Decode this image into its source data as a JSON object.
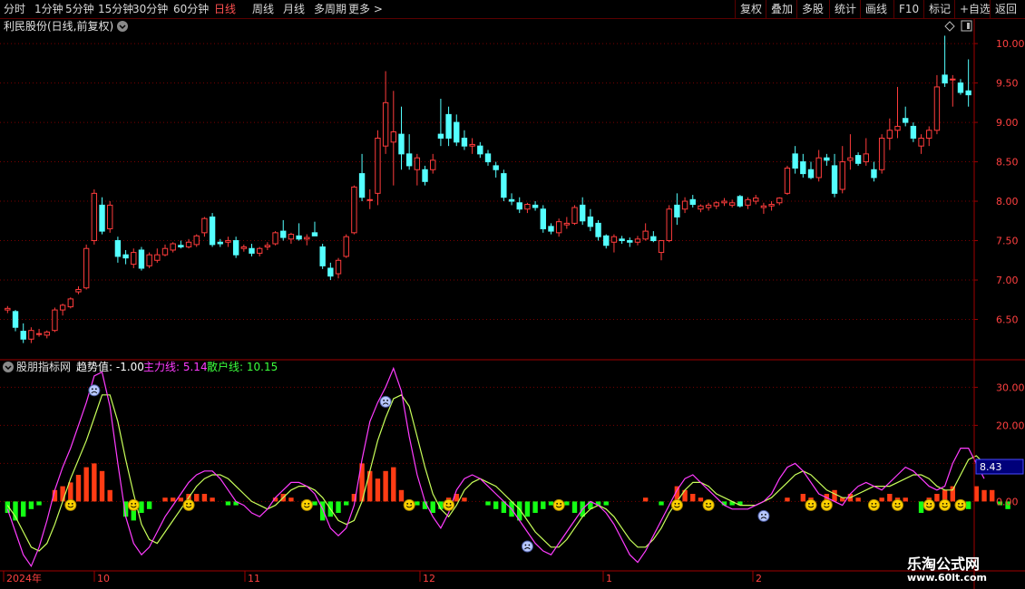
{
  "toolbar": {
    "left": [
      "分时",
      "1分钟",
      "5分钟",
      "15分钟",
      "30分钟",
      "60分钟",
      "日线",
      "周线",
      "月线",
      "多周期",
      "更多 >"
    ],
    "active": "日线",
    "right": [
      "复权",
      "叠加",
      "多股",
      "统计",
      "画线",
      "F10",
      "标记",
      "+自选",
      "返回"
    ]
  },
  "price_panel": {
    "title": "利民股份(日线,前复权)",
    "yticks": [
      "10.00",
      "9.50",
      "9.00",
      "8.50",
      "8.00",
      "7.50",
      "7.00",
      "6.50"
    ]
  },
  "indicator_panel": {
    "name": "股朋指标网",
    "trend_label": "趋势值: -1.00",
    "main_label": "主力线: 5.14",
    "retail_label": "散户线: 10.15",
    "yticks": [
      "30.00",
      "20.00",
      "10.00",
      "0.00"
    ],
    "current_tag": "8.43"
  },
  "xaxis": {
    "labels": [
      "2024年",
      "10",
      "11",
      "12",
      "1",
      "2"
    ]
  },
  "watermark": {
    "name": "乐淘公式网",
    "url": "www.60lt.com"
  },
  "colors": {
    "up": "#ff3c3c",
    "down": "#54ffff",
    "main_line": "#ff3cff",
    "retail_line": "#c8ff5a",
    "bar_pos": "#ff3c14",
    "bar_neg": "#14ff14",
    "grid": "#7a0000"
  },
  "chart_data": [
    {
      "type": "candlestick",
      "title": "利民股份(日线,前复权)",
      "ylim": [
        6.0,
        10.3
      ],
      "ohlc": [
        [
          6.62,
          6.67,
          6.58,
          6.64
        ],
        [
          6.6,
          6.62,
          6.35,
          6.4
        ],
        [
          6.35,
          6.45,
          6.2,
          6.25
        ],
        [
          6.25,
          6.4,
          6.2,
          6.36
        ],
        [
          6.32,
          6.38,
          6.28,
          6.32
        ],
        [
          6.3,
          6.36,
          6.26,
          6.34
        ],
        [
          6.36,
          6.65,
          6.34,
          6.62
        ],
        [
          6.62,
          6.7,
          6.55,
          6.68
        ],
        [
          6.66,
          6.78,
          6.64,
          6.76
        ],
        [
          6.85,
          6.92,
          6.82,
          6.88
        ],
        [
          6.9,
          7.45,
          6.88,
          7.4
        ],
        [
          7.5,
          8.15,
          7.45,
          8.1
        ],
        [
          7.95,
          8.05,
          7.58,
          7.62
        ],
        [
          7.65,
          8.0,
          7.6,
          7.95
        ],
        [
          7.5,
          7.55,
          7.22,
          7.3
        ],
        [
          7.32,
          7.38,
          7.2,
          7.28
        ],
        [
          7.2,
          7.4,
          7.15,
          7.35
        ],
        [
          7.38,
          7.42,
          7.12,
          7.15
        ],
        [
          7.18,
          7.35,
          7.15,
          7.32
        ],
        [
          7.25,
          7.4,
          7.22,
          7.32
        ],
        [
          7.32,
          7.45,
          7.3,
          7.4
        ],
        [
          7.38,
          7.48,
          7.35,
          7.46
        ],
        [
          7.44,
          7.5,
          7.4,
          7.42
        ],
        [
          7.42,
          7.52,
          7.4,
          7.48
        ],
        [
          7.45,
          7.58,
          7.42,
          7.56
        ],
        [
          7.6,
          7.8,
          7.55,
          7.78
        ],
        [
          7.8,
          7.85,
          7.42,
          7.45
        ],
        [
          7.48,
          7.52,
          7.42,
          7.46
        ],
        [
          7.48,
          7.55,
          7.42,
          7.5
        ],
        [
          7.5,
          7.55,
          7.28,
          7.32
        ],
        [
          7.4,
          7.45,
          7.36,
          7.42
        ],
        [
          7.4,
          7.46,
          7.3,
          7.34
        ],
        [
          7.34,
          7.42,
          7.3,
          7.4
        ],
        [
          7.42,
          7.48,
          7.38,
          7.44
        ],
        [
          7.46,
          7.62,
          7.44,
          7.6
        ],
        [
          7.62,
          7.76,
          7.5,
          7.54
        ],
        [
          7.52,
          7.6,
          7.46,
          7.58
        ],
        [
          7.56,
          7.72,
          7.5,
          7.52
        ],
        [
          7.52,
          7.58,
          7.44,
          7.54
        ],
        [
          7.6,
          7.74,
          7.56,
          7.56
        ],
        [
          7.42,
          7.46,
          7.14,
          7.18
        ],
        [
          7.15,
          7.22,
          7.0,
          7.05
        ],
        [
          7.08,
          7.28,
          7.02,
          7.25
        ],
        [
          7.3,
          7.58,
          7.28,
          7.55
        ],
        [
          7.6,
          8.2,
          7.58,
          8.18
        ],
        [
          8.35,
          8.6,
          8.0,
          8.05
        ],
        [
          8.02,
          8.15,
          7.9,
          8.02
        ],
        [
          8.1,
          8.9,
          7.95,
          8.8
        ],
        [
          8.7,
          9.65,
          8.6,
          9.25
        ],
        [
          8.75,
          9.4,
          8.2,
          8.88
        ],
        [
          8.85,
          9.2,
          8.4,
          8.6
        ],
        [
          8.6,
          8.85,
          8.4,
          8.45
        ],
        [
          8.4,
          8.6,
          8.2,
          8.55
        ],
        [
          8.4,
          8.45,
          8.2,
          8.25
        ],
        [
          8.4,
          8.6,
          8.35,
          8.52
        ],
        [
          8.85,
          9.3,
          8.7,
          8.8
        ],
        [
          9.1,
          9.2,
          8.7,
          8.8
        ],
        [
          9.0,
          9.1,
          8.7,
          8.75
        ],
        [
          8.8,
          8.9,
          8.65,
          8.7
        ],
        [
          8.7,
          8.8,
          8.6,
          8.72
        ],
        [
          8.7,
          8.75,
          8.55,
          8.6
        ],
        [
          8.6,
          8.65,
          8.45,
          8.5
        ],
        [
          8.45,
          8.5,
          8.3,
          8.4
        ],
        [
          8.35,
          8.4,
          8.0,
          8.05
        ],
        [
          8.02,
          8.1,
          7.95,
          8.0
        ],
        [
          7.98,
          8.05,
          7.85,
          7.9
        ],
        [
          7.9,
          7.98,
          7.85,
          7.96
        ],
        [
          7.95,
          8.0,
          7.88,
          7.92
        ],
        [
          7.9,
          7.95,
          7.6,
          7.65
        ],
        [
          7.68,
          7.72,
          7.58,
          7.62
        ],
        [
          7.6,
          7.78,
          7.55,
          7.74
        ],
        [
          7.7,
          7.8,
          7.65,
          7.72
        ],
        [
          7.72,
          7.95,
          7.7,
          7.92
        ],
        [
          7.95,
          8.05,
          7.7,
          7.75
        ],
        [
          7.8,
          7.9,
          7.62,
          7.68
        ],
        [
          7.72,
          7.76,
          7.5,
          7.55
        ],
        [
          7.56,
          7.58,
          7.4,
          7.44
        ],
        [
          7.48,
          7.58,
          7.35,
          7.55
        ],
        [
          7.52,
          7.56,
          7.46,
          7.5
        ],
        [
          7.5,
          7.54,
          7.42,
          7.48
        ],
        [
          7.48,
          7.56,
          7.44,
          7.52
        ],
        [
          7.52,
          7.72,
          7.5,
          7.62
        ],
        [
          7.55,
          7.62,
          7.48,
          7.5
        ],
        [
          7.35,
          7.5,
          7.25,
          7.5
        ],
        [
          7.5,
          7.95,
          7.48,
          7.9
        ],
        [
          7.95,
          8.1,
          7.7,
          7.8
        ],
        [
          7.9,
          8.05,
          7.85,
          8.0
        ],
        [
          8.02,
          8.08,
          7.92,
          7.96
        ],
        [
          7.9,
          7.96,
          7.86,
          7.94
        ],
        [
          7.92,
          7.98,
          7.88,
          7.95
        ],
        [
          7.94,
          8.0,
          7.9,
          7.98
        ],
        [
          7.98,
          8.04,
          7.94,
          8.0
        ],
        [
          7.95,
          8.02,
          7.92,
          7.98
        ],
        [
          8.06,
          8.08,
          7.92,
          7.94
        ],
        [
          7.95,
          8.05,
          7.9,
          8.02
        ],
        [
          8.0,
          8.08,
          7.96,
          8.04
        ],
        [
          7.92,
          7.98,
          7.84,
          7.94
        ],
        [
          7.94,
          8.0,
          7.88,
          7.96
        ],
        [
          7.98,
          8.05,
          7.95,
          8.04
        ],
        [
          8.1,
          8.45,
          8.08,
          8.42
        ],
        [
          8.6,
          8.7,
          8.35,
          8.42
        ],
        [
          8.5,
          8.6,
          8.3,
          8.35
        ],
        [
          8.4,
          8.5,
          8.28,
          8.3
        ],
        [
          8.3,
          8.65,
          8.25,
          8.55
        ],
        [
          8.55,
          8.6,
          8.45,
          8.52
        ],
        [
          8.45,
          8.6,
          8.05,
          8.1
        ],
        [
          8.15,
          8.7,
          8.1,
          8.5
        ],
        [
          8.52,
          8.85,
          8.4,
          8.55
        ],
        [
          8.58,
          8.62,
          8.45,
          8.48
        ],
        [
          8.5,
          8.8,
          8.45,
          8.6
        ],
        [
          8.4,
          8.5,
          8.25,
          8.3
        ],
        [
          8.4,
          8.85,
          8.35,
          8.8
        ],
        [
          8.8,
          9.05,
          8.65,
          8.9
        ],
        [
          8.9,
          9.45,
          8.8,
          8.95
        ],
        [
          9.05,
          9.2,
          8.95,
          9.0
        ],
        [
          8.95,
          9.0,
          8.75,
          8.8
        ],
        [
          8.7,
          8.85,
          8.6,
          8.8
        ],
        [
          8.8,
          8.95,
          8.7,
          8.9
        ],
        [
          8.9,
          9.6,
          8.85,
          9.45
        ],
        [
          9.6,
          10.1,
          9.45,
          9.5
        ],
        [
          9.55,
          9.6,
          9.2,
          9.55
        ],
        [
          9.5,
          9.55,
          9.35,
          9.38
        ],
        [
          9.4,
          9.8,
          9.2,
          9.35
        ]
      ],
      "yticks": [
        10.0,
        9.5,
        9.0,
        8.5,
        8.0,
        7.5,
        7.0,
        6.5
      ]
    },
    {
      "type": "mixed",
      "name": "股朋指标网",
      "ylim": [
        -18,
        37
      ],
      "yticks": [
        30,
        20,
        10,
        0
      ],
      "series": [
        {
          "name": "主力线",
          "type": "line",
          "values": [
            -2,
            -8,
            -14,
            -17,
            -12,
            -5,
            3,
            9,
            14,
            20,
            26,
            33,
            34,
            25,
            10,
            -4,
            -11,
            -14,
            -12,
            -8,
            -4,
            -1,
            2,
            5,
            7,
            8,
            8,
            6,
            3,
            0,
            -1,
            -3,
            -4,
            -2,
            1,
            3,
            5,
            5,
            4,
            2,
            -2,
            -7,
            -9,
            -7,
            -1,
            11,
            21,
            26,
            30,
            35,
            29,
            17,
            7,
            0,
            -4,
            -7,
            -3,
            3,
            6,
            7,
            6,
            4,
            2,
            0,
            -2,
            -5,
            -8,
            -11,
            -13,
            -14,
            -11,
            -8,
            -5,
            -2,
            0,
            -1,
            -3,
            -6,
            -10,
            -14,
            -16,
            -13,
            -9,
            -5,
            -1,
            3,
            6,
            7,
            5,
            3,
            1,
            -1,
            -2,
            -2,
            -2,
            -1,
            0,
            2,
            6,
            9,
            10,
            8,
            5,
            2,
            1,
            0,
            -1,
            2,
            4,
            5,
            4,
            3,
            5,
            7,
            9,
            8,
            6,
            4,
            3,
            4,
            10,
            14,
            14,
            10,
            6
          ]
        },
        {
          "name": "散户线",
          "type": "line",
          "values": [
            -1,
            -4,
            -8,
            -12,
            -13,
            -11,
            -6,
            0,
            6,
            11,
            16,
            22,
            28,
            28,
            21,
            11,
            2,
            -6,
            -10,
            -11,
            -8,
            -5,
            -2,
            1,
            4,
            6,
            7,
            7,
            6,
            4,
            2,
            0,
            -1,
            -2,
            -1,
            1,
            3,
            4,
            4,
            3,
            1,
            -2,
            -5,
            -6,
            -5,
            0,
            8,
            16,
            22,
            27,
            28,
            25,
            17,
            9,
            2,
            -2,
            -4,
            -1,
            3,
            5,
            6,
            5,
            4,
            2,
            0,
            -2,
            -5,
            -8,
            -10,
            -12,
            -12,
            -10,
            -7,
            -4,
            -2,
            -1,
            -2,
            -4,
            -7,
            -10,
            -12,
            -12,
            -10,
            -7,
            -3,
            0,
            3,
            5,
            5,
            4,
            2,
            1,
            0,
            -1,
            -1,
            -1,
            0,
            1,
            3,
            5,
            7,
            8,
            7,
            5,
            3,
            2,
            1,
            1,
            2,
            3,
            4,
            4,
            4,
            5,
            6,
            7,
            7,
            6,
            4,
            3,
            3,
            7,
            11,
            12,
            10,
            8
          ]
        },
        {
          "name": "趋势值",
          "type": "bar",
          "values": [
            -3,
            -5,
            -4,
            -2,
            -1,
            0,
            3,
            4,
            5,
            7,
            9,
            10,
            8,
            3,
            0,
            -4,
            -5,
            -3,
            -2,
            0,
            1,
            1,
            1,
            2,
            2,
            2,
            1,
            0,
            -1,
            -1,
            0,
            0,
            0,
            0,
            1,
            2,
            1,
            0,
            0,
            -1,
            -5,
            -4,
            -3,
            -1,
            2,
            10,
            8,
            6,
            8,
            9,
            3,
            0,
            -1,
            -2,
            -3,
            -2,
            1,
            2,
            1,
            0,
            0,
            -1,
            -2,
            -3,
            -4,
            -5,
            -4,
            -3,
            -2,
            -1,
            0,
            -1,
            -3,
            -4,
            -2,
            -1,
            -1,
            0,
            0,
            0,
            0,
            1,
            0,
            -1,
            0,
            4,
            3,
            2,
            1,
            0,
            0,
            -1,
            -1,
            -1,
            0,
            0,
            0,
            0,
            0,
            1,
            0,
            2,
            1,
            0,
            2,
            3,
            1,
            2,
            1,
            0,
            -2,
            1,
            2,
            1,
            1,
            0,
            -3,
            1,
            2,
            3,
            4,
            0,
            -2,
            4,
            3,
            3,
            -1,
            -2
          ]
        }
      ],
      "smiley_up_days": [
        11,
        48,
        66,
        96
      ],
      "smiley_down_days": [
        8,
        16,
        23,
        38,
        51,
        56,
        70,
        85,
        89,
        102,
        104,
        110,
        113,
        117,
        119,
        121
      ]
    }
  ]
}
